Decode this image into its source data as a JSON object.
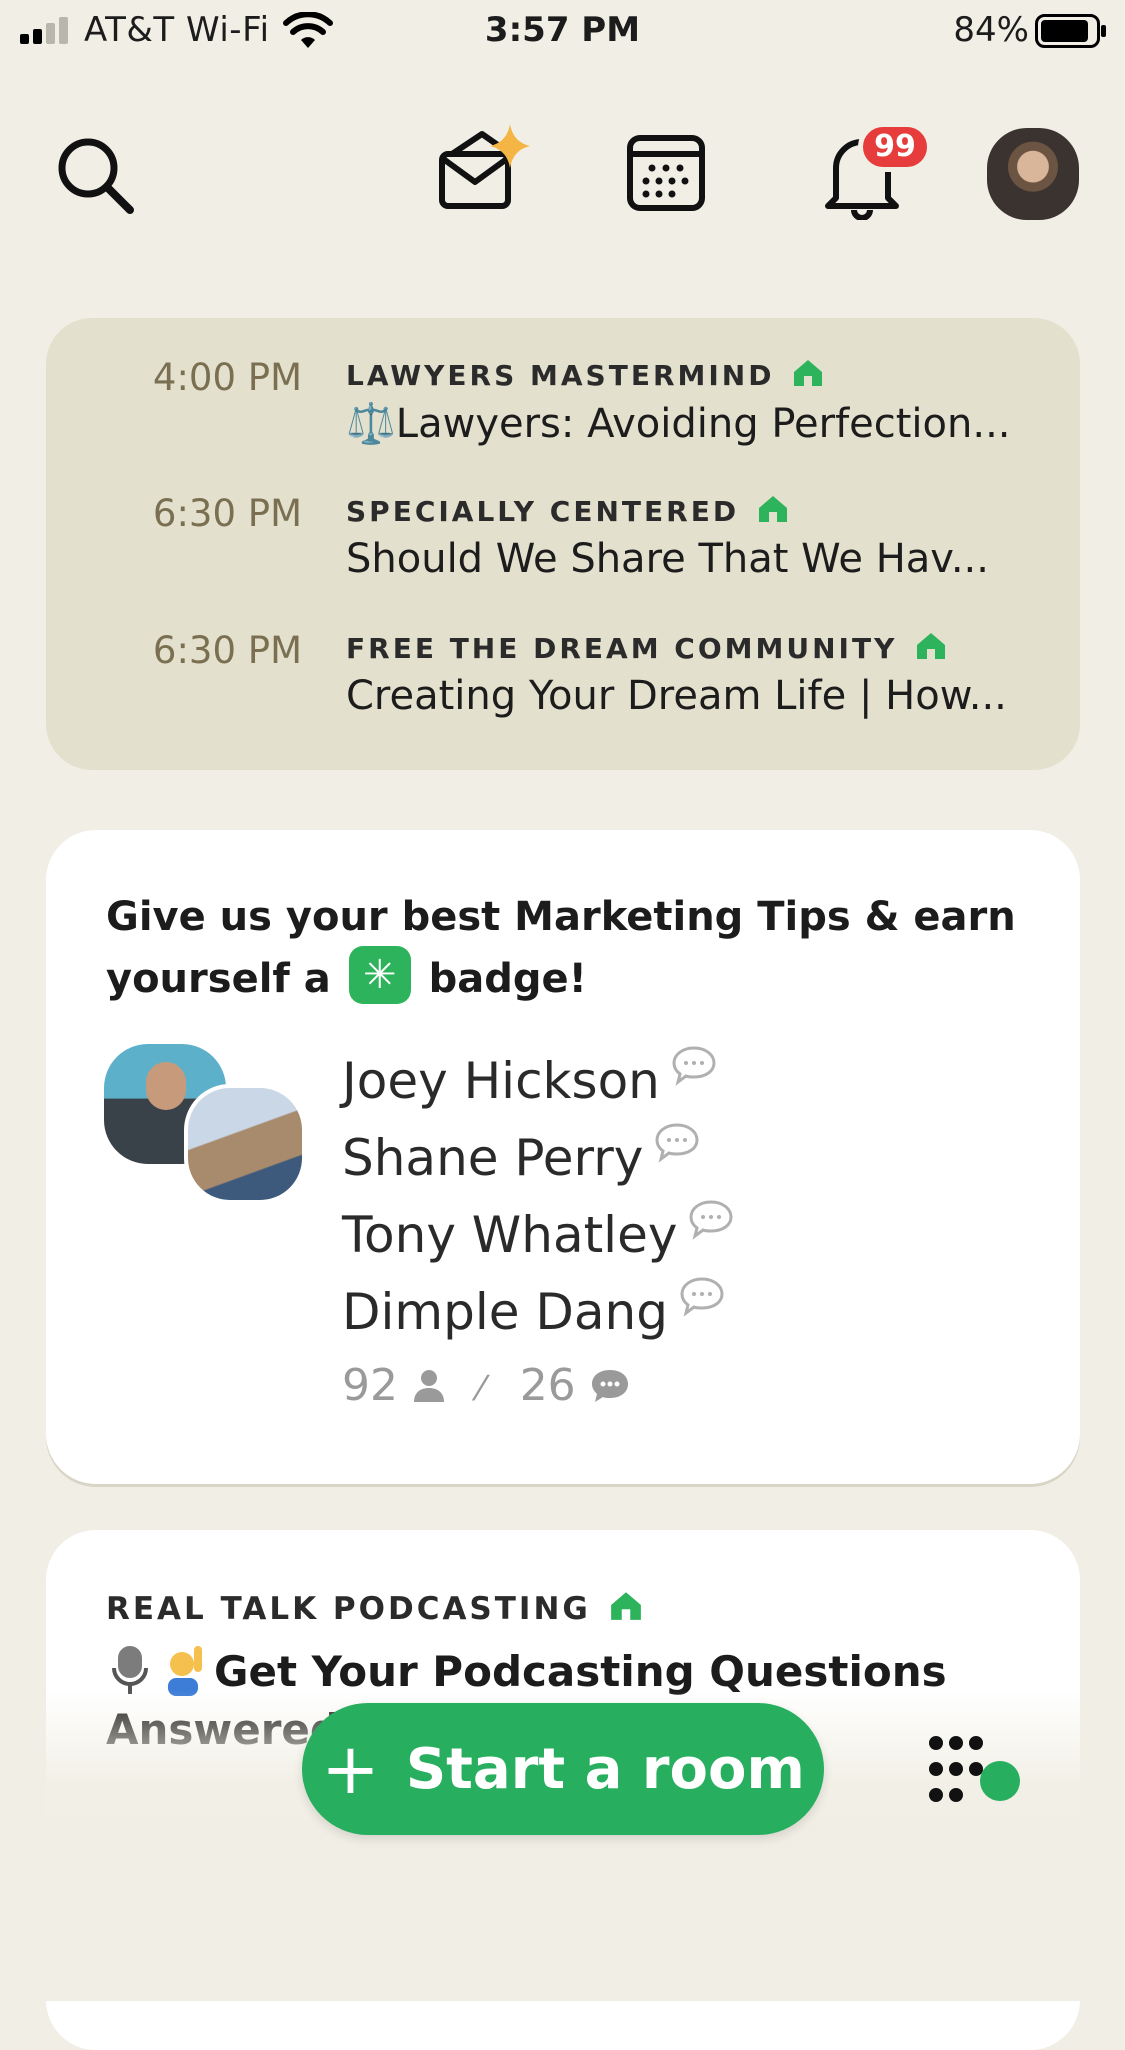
{
  "status_bar": {
    "carrier": "AT&T Wi-Fi",
    "time": "3:57 PM",
    "battery_pct": "84%"
  },
  "header": {
    "notification_count": "99",
    "icons": [
      "search-icon",
      "inbox-sparkle-icon",
      "calendar-icon",
      "bell-icon",
      "profile-avatar"
    ]
  },
  "upcoming": [
    {
      "time": "4:00 PM",
      "club": "LAWYERS MASTERMIND",
      "title": "⚖️Lawyers: Avoiding Perfection..."
    },
    {
      "time": "6:30 PM",
      "club": "SPECIALLY CENTERED",
      "title": "Should We Share That We Hav..."
    },
    {
      "time": "6:30 PM",
      "club": "FREE THE DREAM COMMUNITY",
      "title": "Creating Your Dream Life | How..."
    }
  ],
  "room": {
    "topic_part1": "Give us your best Marketing Tips & earn yourself a",
    "topic_part2": "badge!",
    "speakers": [
      "Joey Hickson",
      "Shane Perry",
      "Tony Whatley",
      "Dimple Dang"
    ],
    "listeners": "92",
    "speakers_count": "26"
  },
  "room2": {
    "club": "REAL TALK PODCASTING",
    "title": "Get Your Podcasting Questions Answered"
  },
  "actions": {
    "start_room": "Start a room"
  },
  "colors": {
    "background": "#F1EFE5",
    "upcoming_card": "#E4E0CE",
    "accent_green": "#27AE5F",
    "badge_red": "#E63C3C",
    "time_text": "#7A7051"
  }
}
